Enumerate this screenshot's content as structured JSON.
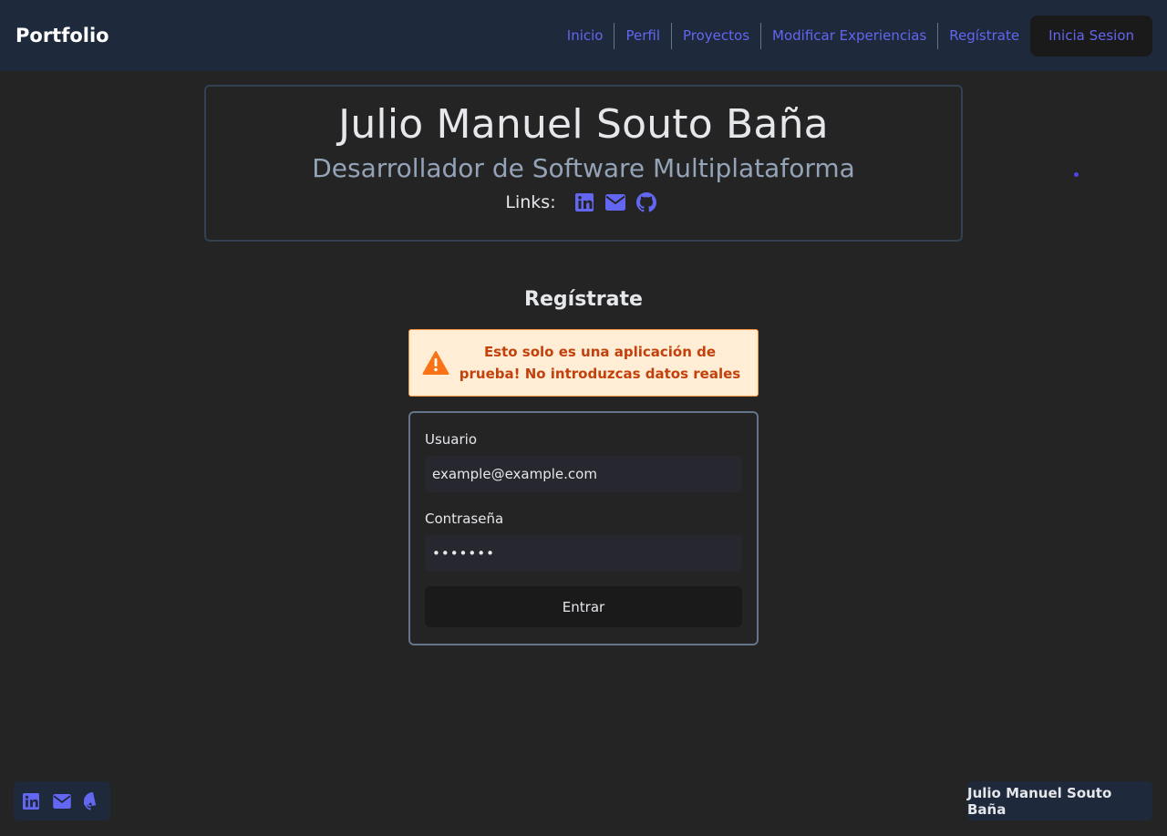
{
  "nav": {
    "brand": "Portfolio",
    "links": [
      "Inicio",
      "Perfil",
      "Proyectos",
      "Modificar Experiencias",
      "Regístrate"
    ],
    "login": "Inicia Sesion"
  },
  "header": {
    "name": "Julio Manuel Souto Baña",
    "subtitle": "Desarrollador de Software Multiplataforma",
    "links_label": "Links:",
    "icons": [
      "linkedin-icon",
      "envelope-icon",
      "github-icon"
    ]
  },
  "register": {
    "title": "Regístrate",
    "alert": "Esto solo es una aplicación de prueba! No introduzcas datos reales",
    "user_label": "Usuario",
    "user_value": "example@example.com",
    "password_label": "Contraseña",
    "password_value": "•••••••",
    "submit": "Entrar"
  },
  "footer": {
    "name": "Julio Manuel Souto Baña"
  },
  "colors": {
    "accent": "#6366f1",
    "navbar": "#1e293b",
    "background": "#242424",
    "alert_bg": "#ffedd5",
    "alert_text": "#c2410c"
  }
}
